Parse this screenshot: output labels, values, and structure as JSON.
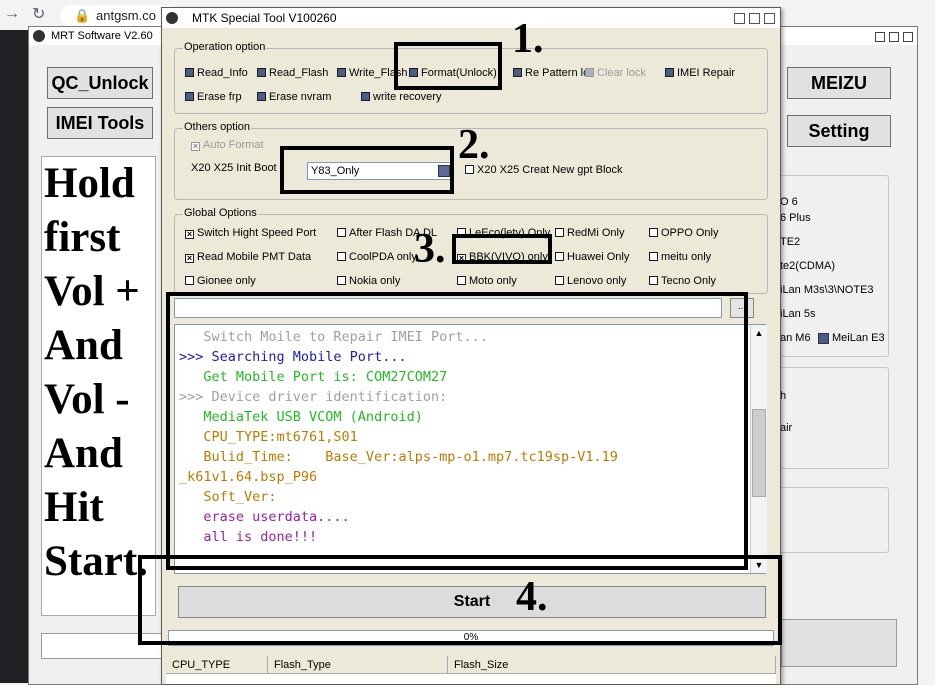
{
  "browser": {
    "back": "→",
    "reload": "↻",
    "url": "antgsm.co"
  },
  "mrt": {
    "title": "MRT Software V2.60",
    "buttons": {
      "qc_unlock": "QC_Unlock",
      "imei_tools": "IMEI Tools",
      "meizu": "MEIZU",
      "setting": "Setting"
    },
    "instructions": [
      "Hold",
      "first",
      "Vol +",
      "And",
      "Vol -",
      "And",
      "Hit",
      "Start."
    ],
    "right_list": [
      "O 6",
      "6 Plus",
      "TE2",
      "te2(CDMA)",
      "iLan M3s\\3\\NOTE3",
      "iLan 5s",
      "an M6",
      "MeiLan E3"
    ],
    "right_partial": [
      "h",
      "air"
    ]
  },
  "mtk": {
    "title": "MTK Special Tool V100260",
    "operation": {
      "label": "Operation option",
      "options": [
        "Read_Info",
        "Read_Flash",
        "Write_Flash",
        "Format(Unlock)",
        "Re Pattern lock",
        "Clear lock",
        "IMEI Repair",
        "Erase frp",
        "Erase nvram",
        "write recovery"
      ]
    },
    "others": {
      "label": "Others option",
      "auto_format": "Auto Format",
      "init_boot_label": "X20 X25 Init Boot",
      "init_boot_value": "Y83_Only",
      "gpt": "X20 X25 Creat New gpt Block"
    },
    "global": {
      "label": "Global Options",
      "options": [
        "Switch Hight Speed Port",
        "After Flash DA DL",
        "LeEco(letv) Only",
        "RedMi Only",
        "OPPO Only",
        "Read Mobile PMT Data",
        "CoolPDA only",
        "BBK(VIVO) only",
        "Huawei Only",
        "meitu only",
        "Gionee only",
        "Nokia only",
        "Moto only",
        "Lenovo only",
        "Tecno Only"
      ]
    },
    "browse_button": "...",
    "log": [
      {
        "text": "   Switch Moile to Repair IMEI Port...",
        "color": "#a0a0a0"
      },
      {
        "text": ">>> Searching Mobile Port...",
        "color": "#1a1acc"
      },
      {
        "text": "   Get Mobile Port is: COM27COM27",
        "color": "#22bb22"
      },
      {
        "text": ">>> Device driver identification:",
        "color": "#a0a0a0"
      },
      {
        "text": "   MediaTek USB VCOM (Android)",
        "color": "#22bb22"
      },
      {
        "text": "   CPU_TYPE:mt6761,S01",
        "color": "#c07a00"
      },
      {
        "text": "   Bulid_Time:    Base_Ver:alps-mp-o1.mp7.tc19sp-V1.19",
        "color": "#c07a00"
      },
      {
        "text": "_k61v1.64.bsp_P96",
        "color": "#c07a00"
      },
      {
        "text": "   Soft_Ver:",
        "color": "#c07a00"
      },
      {
        "text": "   erase userdata....",
        "color": "#9b1fa8"
      },
      {
        "text": "   all is done!!!",
        "color": "#9b1fa8"
      }
    ],
    "start": "Start",
    "progress": {
      "label": "0%",
      "value": 0
    },
    "table_headers": [
      "CPU_TYPE",
      "Flash_Type",
      "Flash_Size"
    ]
  },
  "annotations": {
    "step1": "1.",
    "step2": "2.",
    "step3": "3.",
    "step4": "4."
  }
}
